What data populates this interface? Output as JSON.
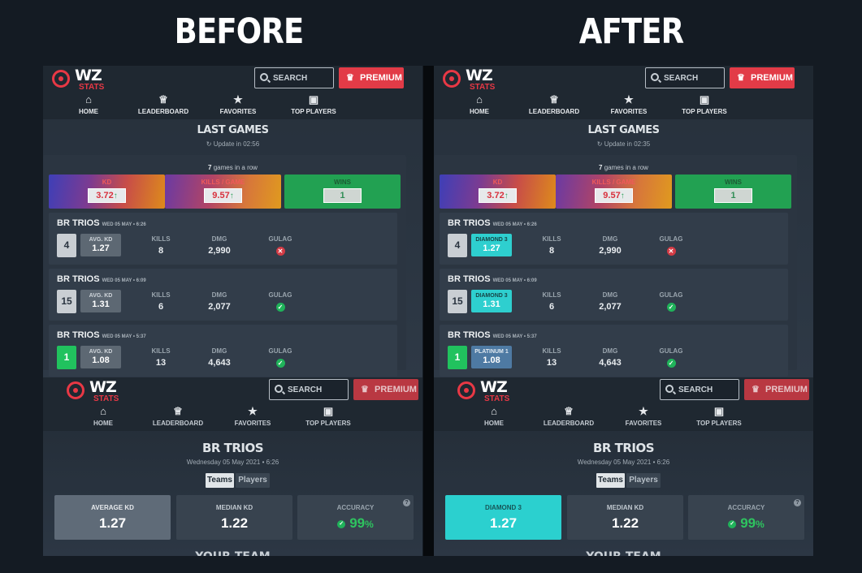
{
  "headings": {
    "before": "BEFORE",
    "after": "AFTER"
  },
  "logo": {
    "main": "WZ",
    "sub": "STATS"
  },
  "header": {
    "search_label": "SEARCH",
    "premium_label": "PREMIUM"
  },
  "nav": [
    {
      "label": "HOME",
      "icon": "home-icon"
    },
    {
      "label": "LEADERBOARD",
      "icon": "trophy-icon"
    },
    {
      "label": "FAVORITES",
      "icon": "star-icon"
    },
    {
      "label": "TOP PLAYERS",
      "icon": "gamepad-icon"
    }
  ],
  "before": {
    "last_games_title": "LAST GAMES",
    "update_text": "Update in 02:56",
    "games_in_row_count": "7",
    "games_in_row_text": " games in a row",
    "stats": [
      {
        "label": "KD",
        "value": "3.72"
      },
      {
        "label": "KILLS / GAME",
        "value": "9.57"
      },
      {
        "label": "WINS",
        "value": "1"
      }
    ],
    "games": [
      {
        "mode": "BR TRIOS",
        "date": "WED 05 MAY • 6:26",
        "placement": "4",
        "kd_label": "AVG. KD",
        "kd": "1.27",
        "kills": "8",
        "dmg": "2,990",
        "gulag": "lost"
      },
      {
        "mode": "BR TRIOS",
        "date": "WED 05 MAY • 6:09",
        "placement": "15",
        "kd_label": "AVG. KD",
        "kd": "1.31",
        "kills": "6",
        "dmg": "2,077",
        "gulag": "won"
      },
      {
        "mode": "BR TRIOS",
        "date": "WED 05 MAY • 5:37",
        "placement": "1",
        "kd_label": "AVG. KD",
        "kd": "1.08",
        "kills": "13",
        "dmg": "4,643",
        "gulag": "won"
      }
    ],
    "match": {
      "title": "BR TRIOS",
      "date": "Wednesday 05 May 2021 • 6:26",
      "tabs": [
        "Teams",
        "Players"
      ],
      "boxes": [
        {
          "label": "AVERAGE KD",
          "value": "1.27"
        },
        {
          "label": "MEDIAN KD",
          "value": "1.22"
        },
        {
          "label": "ACCURACY",
          "value": "99",
          "unit": "%"
        }
      ],
      "your_team": "YOUR TEAM"
    }
  },
  "after": {
    "last_games_title": "LAST GAMES",
    "update_text": "Update in 02:35",
    "games_in_row_count": "7",
    "games_in_row_text": " games in a row",
    "stats": [
      {
        "label": "KD",
        "value": "3.72"
      },
      {
        "label": "KILLS / GAME",
        "value": "9.57"
      },
      {
        "label": "WINS",
        "value": "1"
      }
    ],
    "games": [
      {
        "mode": "BR TRIOS",
        "date": "WED 05 MAY • 6:26",
        "placement": "4",
        "kd_label": "DIAMOND 3",
        "kd": "1.27",
        "kills": "8",
        "dmg": "2,990",
        "gulag": "lost"
      },
      {
        "mode": "BR TRIOS",
        "date": "WED 05 MAY • 6:09",
        "placement": "15",
        "kd_label": "DIAMOND 3",
        "kd": "1.31",
        "kills": "6",
        "dmg": "2,077",
        "gulag": "won"
      },
      {
        "mode": "BR TRIOS",
        "date": "WED 05 MAY • 5:37",
        "placement": "1",
        "kd_label": "PLATINUM 1",
        "kd": "1.08",
        "kills": "13",
        "dmg": "4,643",
        "gulag": "won"
      }
    ],
    "match": {
      "title": "BR TRIOS",
      "date": "Wednesday 05 May 2021 • 6:26",
      "tabs": [
        "Teams",
        "Players"
      ],
      "boxes": [
        {
          "label": "DIAMOND 3",
          "value": "1.27"
        },
        {
          "label": "MEDIAN KD",
          "value": "1.22"
        },
        {
          "label": "ACCURACY",
          "value": "99",
          "unit": "%"
        }
      ],
      "your_team": "YOUR TEAM"
    }
  },
  "col_labels": {
    "kills": "KILLS",
    "dmg": "DMG",
    "gulag": "GULAG"
  },
  "colors": {
    "premium": "#e23b47",
    "diamond": "#2ecfcf",
    "platinum": "#4e7aa3",
    "wins": "#22a152",
    "first_place": "#21c25e"
  }
}
